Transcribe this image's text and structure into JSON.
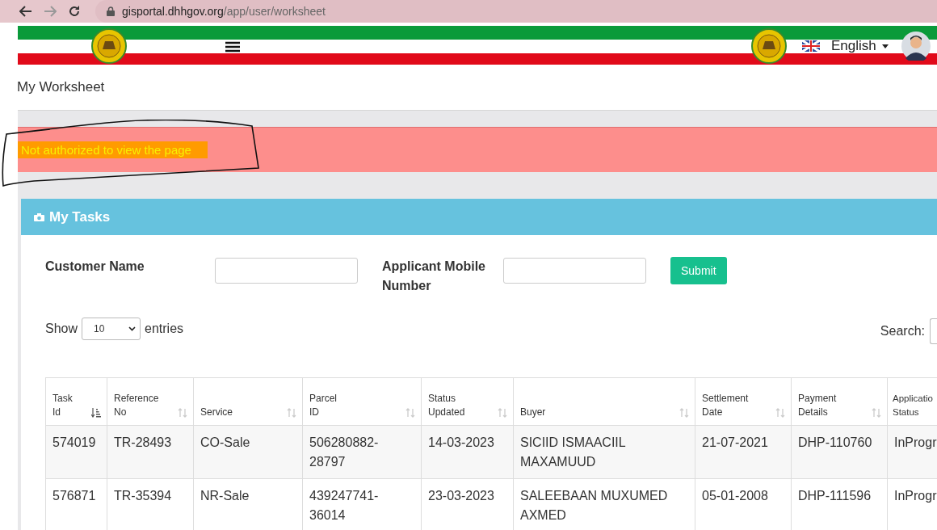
{
  "browser": {
    "url_host": "gisportal.dhhgov.org",
    "url_path": "/app/user/worksheet"
  },
  "header": {
    "language": "English"
  },
  "page_title": "My Worksheet",
  "alert": {
    "message": "Not authorized to view the page"
  },
  "panel": {
    "title": "My Tasks"
  },
  "filters": [
    {
      "label": "Customer Name"
    },
    {
      "label": "Applicant Mobile Number"
    }
  ],
  "submit": "Submit",
  "length": {
    "show": "Show",
    "value": "10",
    "entries": "entries"
  },
  "search": {
    "label": "Search:"
  },
  "table": {
    "columns": [
      {
        "label": "Task Id",
        "sorted": true
      },
      {
        "label": "Reference No",
        "sorted": false
      },
      {
        "label": "Service",
        "sorted": false
      },
      {
        "label": "Parcel ID",
        "sorted": false
      },
      {
        "label": "Status Updated",
        "sorted": false
      },
      {
        "label": "Buyer",
        "sorted": false
      },
      {
        "label": "Settlement Date",
        "sorted": false
      },
      {
        "label": "Payment Details",
        "sorted": false
      },
      {
        "label": "Applicatio Status"
      }
    ],
    "rows": [
      [
        "574019",
        "TR-28493",
        "CO-Sale",
        "506280882-28797",
        "14-03-2023",
        "SICIID ISMAACIIL MAXAMUUD",
        "21-07-2021",
        "DHP-110760",
        "InProgr"
      ],
      [
        "576871",
        "TR-35394",
        "NR-Sale",
        "439247741-36014",
        "23-03-2023",
        "SALEEBAAN MUXUMED AXMED",
        "05-01-2008",
        "DHP-111596",
        "InProgr"
      ]
    ]
  }
}
